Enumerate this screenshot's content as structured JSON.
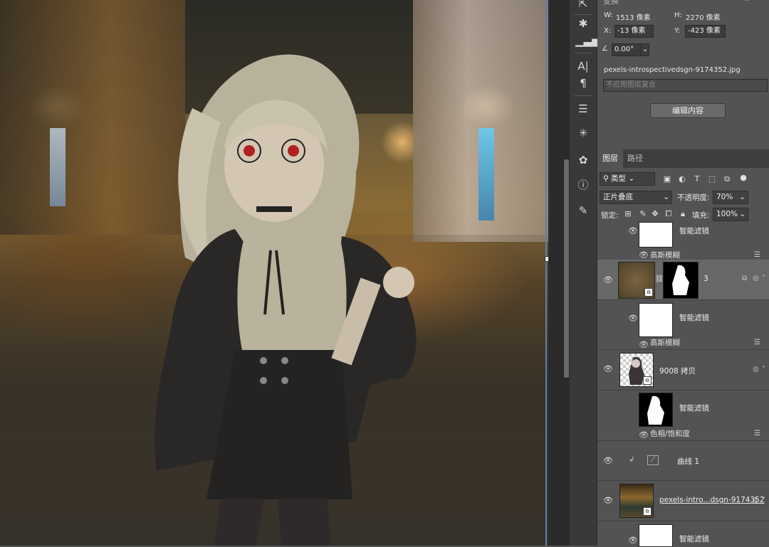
{
  "transform": {
    "w_label": "W:",
    "w_value": "1513 像素",
    "h_label": "H:",
    "h_value": "2270 像素",
    "x_label": "X:",
    "x_value": "-13 像素",
    "y_label": "Y:",
    "y_value": "-423 像素",
    "angle_value": "0.00°",
    "filename": "pexels-introspectivedsgn-9174352.jpg",
    "comp_placeholder": "不应用图层复合",
    "edit_button": "编辑内容"
  },
  "layers_tabs": [
    "图层",
    "路径"
  ],
  "filter_kind": "类型",
  "blend_mode": "正片叠底",
  "opacity_label": "不透明度:",
  "opacity_value": "70%",
  "lock_label": "锁定:",
  "fill_label": "填充:",
  "fill_value": "100%",
  "layers": [
    {
      "type": "smart-filter",
      "label": "智能滤镜",
      "filter": "高斯模糊"
    },
    {
      "type": "layer",
      "name": "3"
    },
    {
      "type": "smart-filter",
      "label": "智能滤镜",
      "filter": "高斯模糊"
    },
    {
      "type": "layer",
      "name": "9008 拷贝"
    },
    {
      "type": "smart-filter",
      "label": "智能滤镜",
      "filter": "色相/饱和度"
    },
    {
      "type": "adjustment",
      "name": "曲线 1"
    },
    {
      "type": "layer",
      "name": "pexels-intro...dsgn-9174352"
    },
    {
      "type": "smart-filter",
      "label": "智能滤镜"
    }
  ],
  "colors": {
    "panel": "#535353",
    "dark": "#393939",
    "selected": "#686868",
    "accent_edge": "#5a7fb0"
  }
}
